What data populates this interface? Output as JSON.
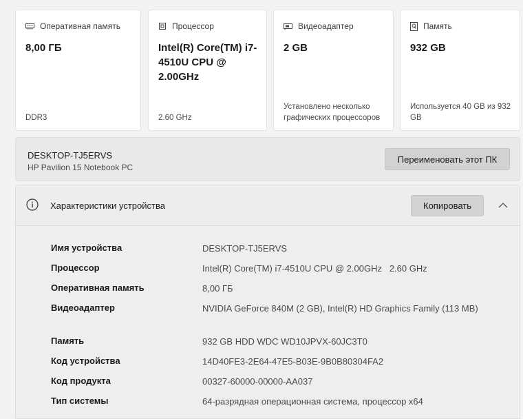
{
  "cards": [
    {
      "title": "Оперативная память",
      "icon": "ram-icon",
      "value": "8,00 ГБ",
      "sub": "DDR3"
    },
    {
      "title": "Процессор",
      "icon": "cpu-icon",
      "value": "Intel(R) Core(TM) i7-4510U CPU @ 2.00GHz",
      "sub": "2.60 GHz"
    },
    {
      "title": "Видеоадаптер",
      "icon": "gpu-icon",
      "value": "2 GB",
      "sub": "Установлено несколько графических процессоров"
    },
    {
      "title": "Память",
      "icon": "storage-icon",
      "value": "932 GB",
      "sub": "Используется 40 GB из 932 GB"
    }
  ],
  "device": {
    "name": "DESKTOP-TJ5ERVS",
    "model": "HP Pavilion 15 Notebook PC",
    "rename_label": "Переименовать этот ПК"
  },
  "specs": {
    "title": "Характеристики устройства",
    "copy_label": "Копировать",
    "rows": [
      {
        "label": "Имя устройства",
        "value": "DESKTOP-TJ5ERVS"
      },
      {
        "label": "Процессор",
        "value": "Intel(R) Core(TM) i7-4510U CPU @ 2.00GHz   2.60 GHz"
      },
      {
        "label": "Оперативная память",
        "value": "8,00 ГБ"
      },
      {
        "label": "Видеоадаптер",
        "value": "NVIDIA GeForce 840M (2 GB), Intel(R) HD Graphics Family (113 MB)"
      },
      {
        "label": "Память",
        "value": "932 GB HDD WDC WD10JPVX-60JC3T0"
      },
      {
        "label": "Код устройства",
        "value": "14D40FE3-2E64-47E5-B03E-9B0B80304FA2"
      },
      {
        "label": "Код продукта",
        "value": "00327-60000-00000-AA037"
      },
      {
        "label": "Тип системы",
        "value": "64-разрядная операционная система, процессор x64"
      }
    ]
  }
}
